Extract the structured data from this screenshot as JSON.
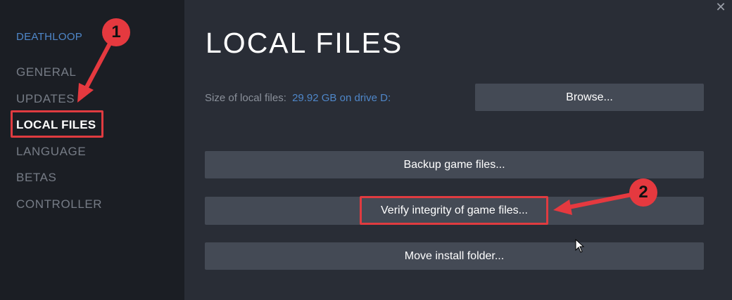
{
  "sidebar": {
    "game_title": "DEATHLOOP",
    "items": [
      {
        "label": "GENERAL"
      },
      {
        "label": "UPDATES"
      },
      {
        "label": "LOCAL FILES"
      },
      {
        "label": "LANGUAGE"
      },
      {
        "label": "BETAS"
      },
      {
        "label": "CONTROLLER"
      }
    ]
  },
  "main": {
    "title": "LOCAL FILES",
    "size_label": "Size of local files:",
    "size_value": "29.92 GB on drive D:",
    "browse_label": "Browse...",
    "backup_label": "Backup game files...",
    "verify_label": "Verify integrity of game files...",
    "move_label": "Move install folder..."
  },
  "window": {
    "close_glyph": "✕"
  },
  "annotations": {
    "step1": "1",
    "step2": "2",
    "color": "#e5393f"
  }
}
